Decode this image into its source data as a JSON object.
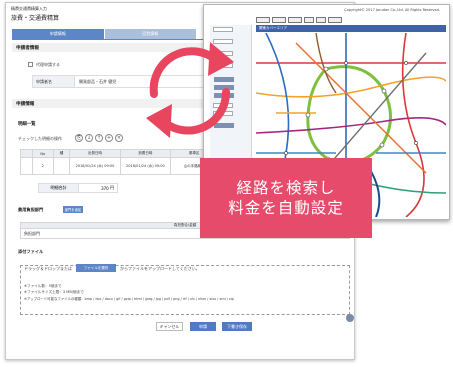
{
  "back_window": {
    "app_title": "精費交通費精算入力",
    "breadcrumb": "旅費・交通費精算",
    "tabs": [
      {
        "label": "申請情報",
        "active": true
      },
      {
        "label": "回覧情報",
        "active": false
      }
    ],
    "applicant_section": {
      "title": "申請者情報",
      "proxy_checkbox_label": "代理申請する",
      "applicant_label": "申請者名",
      "applicant_value": "開発部品・石井 健児"
    },
    "detail_section": {
      "title": "申請情報",
      "list_title": "明細一覧",
      "toolbar_label": "チェックした明細の操作",
      "table": {
        "headers": [
          "No",
          "種",
          "出発日時",
          "到着日時",
          "乗車区",
          "手段"
        ],
        "rows": [
          {
            "no": "2",
            "depart": "2018/01/24 (水) 09:00",
            "arrive": "2018/01/24 (水) 09:00",
            "route": "山の手路線鉄",
            "means": "京浜線路"
          }
        ]
      },
      "total_label": "明細合計",
      "total_value": "370",
      "total_unit": "円"
    },
    "department": {
      "title": "費用負担部門",
      "chip_label": "部門を追加",
      "header": "負担割合/金額",
      "row_label": "負担部門",
      "pct_value": "100.00",
      "pct_unit": "%",
      "amount_value": "370",
      "amount_unit": "円"
    },
    "attachments": {
      "title": "添付ファイル",
      "drop_text_before": "ドラッグ＆ドロップまたは",
      "file_button": "ファイルを選択",
      "drop_text_after": "からファイルをアップロードしてください。",
      "notes": [
        "※ファイル数：5個まで",
        "※ファイルサイズ上限：3 MB/個まで",
        "※アップロード可能なファイルの種類：bmp / doc / docx / gif / gzip / html / jpeg / jpg / pdf / png / rtf / xls / xlsm / xlsx / xml / zip"
      ]
    },
    "buttons": {
      "cancel": "キャンセル",
      "apply": "申請",
      "draft": "下書き保存"
    }
  },
  "front_window": {
    "copyright": "Copyright© 2017 Jorudan Co.,Ltd. All Rights Reserved.",
    "map_title": "関東カバーエリア",
    "accent_color": "#3f63a6"
  },
  "callout": {
    "line1": "経路を検索し",
    "line2": "料金を自動設定",
    "color": "#e74b6c"
  },
  "colors": {
    "primary": "#5d86c6",
    "arrow": "#e8455f"
  }
}
